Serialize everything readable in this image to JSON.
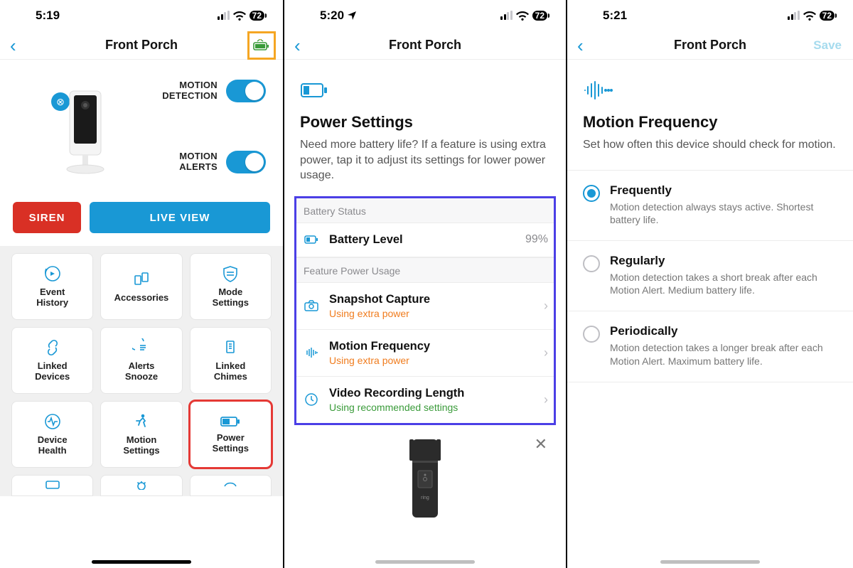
{
  "status": {
    "battery_pill": "72"
  },
  "panel1": {
    "time": "5:19",
    "title": "Front Porch",
    "toggles": {
      "motion_detection_label": "MOTION\nDETECTION",
      "motion_alerts_label": "MOTION\nALERTS"
    },
    "buttons": {
      "siren": "SIREN",
      "live": "LIVE VIEW"
    },
    "tiles": [
      {
        "label": "Event\nHistory"
      },
      {
        "label": "Accessories"
      },
      {
        "label": "Mode\nSettings"
      },
      {
        "label": "Linked\nDevices"
      },
      {
        "label": "Alerts\nSnooze"
      },
      {
        "label": "Linked\nChimes"
      },
      {
        "label": "Device\nHealth"
      },
      {
        "label": "Motion\nSettings"
      },
      {
        "label": "Power\nSettings"
      }
    ]
  },
  "panel2": {
    "time": "5:20",
    "title": "Front Porch",
    "heading": "Power Settings",
    "description": "Need more battery life? If a feature is using extra power, tap it to adjust its settings for lower power usage.",
    "sections": {
      "battery_status": "Battery Status",
      "battery_level_label": "Battery Level",
      "battery_level_value": "99%",
      "feature_power_usage": "Feature Power Usage"
    },
    "rows": [
      {
        "title": "Snapshot Capture",
        "sub": "Using extra power",
        "cls": "orange"
      },
      {
        "title": "Motion Frequency",
        "sub": "Using extra power",
        "cls": "orange"
      },
      {
        "title": "Video Recording Length",
        "sub": "Using recommended settings",
        "cls": "green"
      }
    ]
  },
  "panel3": {
    "time": "5:21",
    "title": "Front Porch",
    "save": "Save",
    "heading": "Motion Frequency",
    "description": "Set how often this device should check for motion.",
    "options": [
      {
        "title": "Frequently",
        "sub": "Motion detection always stays active. Shortest battery life.",
        "selected": true
      },
      {
        "title": "Regularly",
        "sub": "Motion detection takes a short break after each Motion Alert. Medium battery life.",
        "selected": false
      },
      {
        "title": "Periodically",
        "sub": "Motion detection takes a longer break after each Motion Alert. Maximum battery life.",
        "selected": false
      }
    ]
  }
}
